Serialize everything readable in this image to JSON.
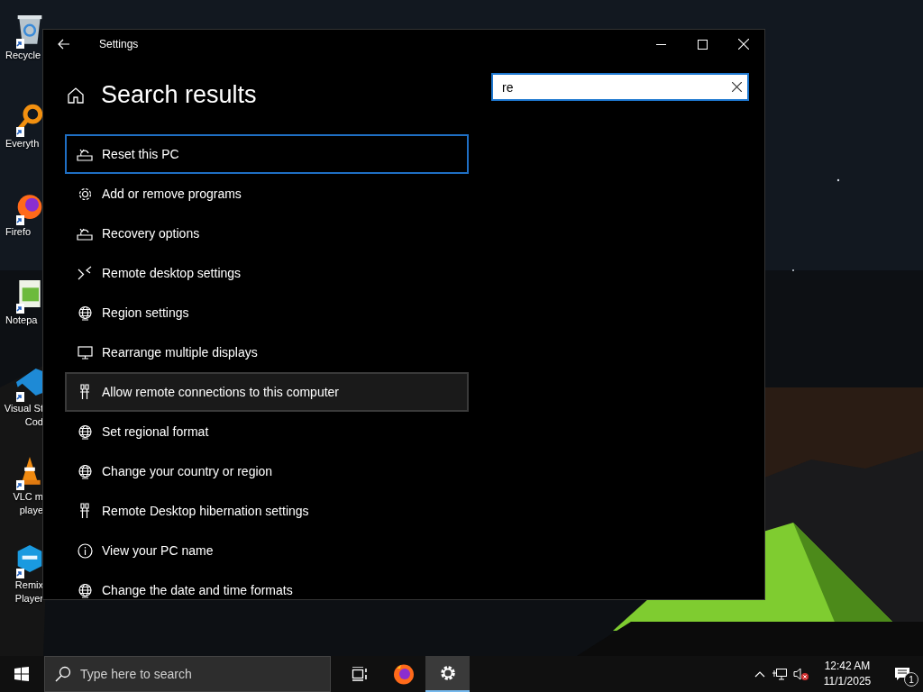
{
  "desktop_icons": [
    {
      "kind": "recycle",
      "label": [
        "Recycle"
      ]
    },
    {
      "kind": "everything",
      "label": [
        "Everyth"
      ]
    },
    {
      "kind": "firefox",
      "label": [
        "Firefo"
      ]
    },
    {
      "kind": "notepad",
      "label": [
        "Notepa"
      ]
    },
    {
      "kind": "vscode",
      "label": [
        "Visual St",
        "Cod"
      ]
    },
    {
      "kind": "vlc",
      "label": [
        "VLC m",
        "playe"
      ]
    },
    {
      "kind": "remix",
      "label": [
        "Remix",
        "Player"
      ]
    }
  ],
  "window": {
    "title": "Settings",
    "heading": "Search results",
    "search": {
      "value": "re"
    },
    "results": [
      {
        "kind": "reset",
        "label": "Reset this PC",
        "selected": true,
        "hovered": false
      },
      {
        "kind": "gear",
        "label": "Add or remove programs",
        "selected": false,
        "hovered": false
      },
      {
        "kind": "reset",
        "label": "Recovery options",
        "selected": false,
        "hovered": false
      },
      {
        "kind": "remote",
        "label": "Remote desktop settings",
        "selected": false,
        "hovered": false
      },
      {
        "kind": "globe",
        "label": "Region settings",
        "selected": false,
        "hovered": false
      },
      {
        "kind": "display",
        "label": "Rearrange multiple displays",
        "selected": false,
        "hovered": false
      },
      {
        "kind": "plug",
        "label": "Allow remote connections to this computer",
        "selected": false,
        "hovered": true
      },
      {
        "kind": "globe",
        "label": "Set regional format",
        "selected": false,
        "hovered": false
      },
      {
        "kind": "globe",
        "label": "Change your country or region",
        "selected": false,
        "hovered": false
      },
      {
        "kind": "plug",
        "label": "Remote Desktop hibernation settings",
        "selected": false,
        "hovered": false
      },
      {
        "kind": "info",
        "label": "View your PC name",
        "selected": false,
        "hovered": false
      },
      {
        "kind": "globe",
        "label": "Change the date and time formats",
        "selected": false,
        "hovered": false
      }
    ]
  },
  "taskbar": {
    "search": {
      "placeholder": "Type here to search"
    },
    "apps": [
      {
        "kind": "taskview",
        "selected": false
      },
      {
        "kind": "firefox",
        "selected": false
      },
      {
        "kind": "settings",
        "selected": true
      }
    ],
    "clock": {
      "time": "12:42 AM",
      "date": "11/1/2025"
    },
    "notifications": {
      "count": "1"
    }
  }
}
